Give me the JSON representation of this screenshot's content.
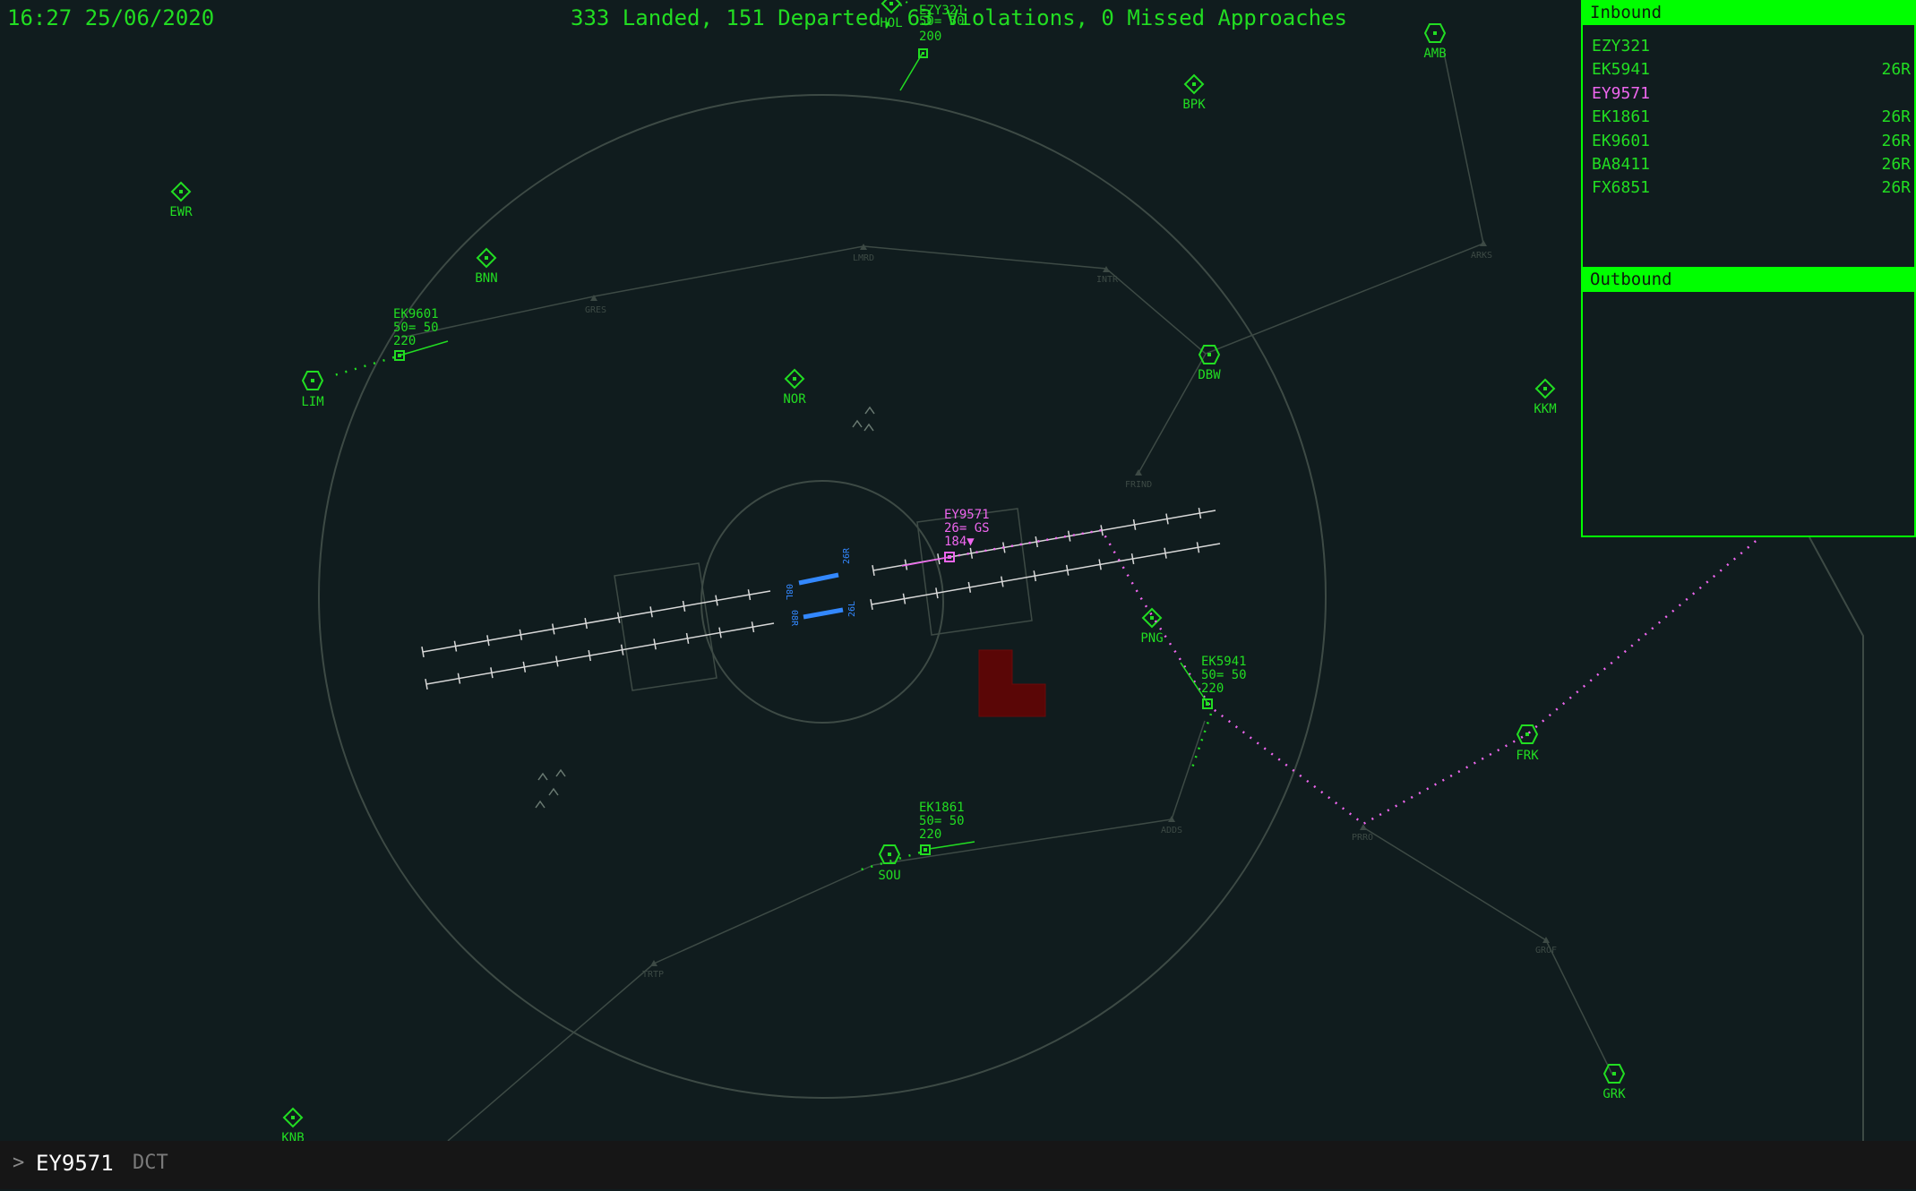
{
  "header": {
    "clock": "16:27 25/06/2020",
    "stats": "333 Landed, 151 Departed, 63 Violations, 0 Missed Approaches"
  },
  "colors": {
    "background": "#101c1e",
    "ui_green": "#00ff00",
    "selected_magenta": "#ee66ee",
    "runway_blue": "#3388ff",
    "restricted_red": "#5a0606"
  },
  "inbound": {
    "title": "Inbound",
    "strips": [
      {
        "callsign": "EZY321",
        "runway": ""
      },
      {
        "callsign": "EK5941",
        "runway": "26R"
      },
      {
        "callsign": "EY9571",
        "runway": ""
      },
      {
        "callsign": "EK1861",
        "runway": "26R"
      },
      {
        "callsign": "EK9601",
        "runway": "26R"
      },
      {
        "callsign": "BA8411",
        "runway": "26R"
      },
      {
        "callsign": "FX6851",
        "runway": "26R"
      }
    ]
  },
  "outbound": {
    "title": "Outbound",
    "strips": []
  },
  "beacons": {
    "EWR": "EWR",
    "BNN": "BNN",
    "LIM": "LIM",
    "NOR": "NOR",
    "BPK": "BPK",
    "AMB": "AMB",
    "DBW": "DBW",
    "KKM": "KKM",
    "PNG": "PNG",
    "FRK": "FRK",
    "SOU": "SOU",
    "GRK": "GRK",
    "KNB": "KNB",
    "HOL": "HOL"
  },
  "fixes": {
    "GRES": "GRES",
    "LMRD": "LMRD",
    "INTR": "INTR",
    "ARKS": "ARKS",
    "FRIND": "FRIND",
    "ADDS": "ADDS",
    "PRRO": "PRRO",
    "GROF": "GROF",
    "TRTP": "TRTP"
  },
  "runways": {
    "r08L": "08L",
    "r26R": "26R",
    "r08R": "08R",
    "r26L": "26L"
  },
  "aircraft": [
    {
      "callsign": "EZY321",
      "line2": "50= 50",
      "line3": "200",
      "selected": false
    },
    {
      "callsign": "EK9601",
      "line2": "50= 50",
      "line3": "220",
      "selected": false
    },
    {
      "callsign": "EY9571",
      "line2": "26= GS",
      "line3": "184▼",
      "selected": true
    },
    {
      "callsign": "EK5941",
      "line2": "50= 50",
      "line3": "220",
      "selected": false
    },
    {
      "callsign": "EK1861",
      "line2": "50= 50",
      "line3": "220",
      "selected": false
    }
  ],
  "command": {
    "prompt": ">",
    "callsign": "EY9571",
    "suggestion": "DCT"
  }
}
